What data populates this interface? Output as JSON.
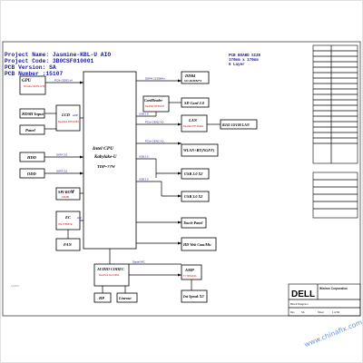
{
  "header": {
    "project_name": "Project Name: Jasmine-KBL-U AIO",
    "project_code": "Project Code: 3B0CSF010001",
    "pcb_version": "PCB Version: SA",
    "pcb_number": "PCB Number :15107"
  },
  "pcb_info": {
    "line1": "PCB BOARD SIZE",
    "line2": "170mm x 170mm",
    "line3": "6 Layer"
  },
  "blocks": {
    "cpu_title": "Intel CPU",
    "cpu_sub": "Kabylake-U",
    "cpu_tdp": "TDP=??W",
    "gpu": "GPU",
    "gpu_note": "NVidia N16S-GTR",
    "hdmi": "HDMI Input",
    "lcd": "LCD",
    "lcd_note": "RealTek RTD2281",
    "panel": "Panel",
    "hdd": "HDD",
    "odd": "ODD",
    "spi": "SPI ROM",
    "spi_note": "16MB",
    "ec": "EC",
    "ec_note": "ITE IT8987E",
    "fan": "FAN",
    "ddr": "DDR4",
    "ddr_sub": "SO-DIMM*2",
    "card_reader": "CardReader",
    "card_reader_note": "RealTek RTS5170",
    "sd": "SD Card 3.0",
    "lan": "LAN",
    "lan_note": "RealTek RTL8111H",
    "rj45": "RJ45 10/100 LAN",
    "wlan": "WLAN+BT(NGFF)",
    "usb2": "USB 2.0 X2",
    "usb3": "USB 3.0 X2",
    "touch": "Touch Panel",
    "hdcam": "HD Web Cam/Mic",
    "audio": "AUDIO CODEC",
    "audio_note": "RealTek ALC3661",
    "amp": "AMP",
    "amp_note": "TI TPA3131",
    "hp": "HP",
    "linein": "Lineout",
    "spk": "Int Speak X2"
  },
  "buses": {
    "pcie_gpu": "PCIe GEN3 x4",
    "dp_lcd": "eDP",
    "pcie_lan": "PCIe GEN2 X1",
    "pcie_wlan": "PCIe GEN2 X1",
    "sata_hdd": "SATA 3.0",
    "sata_odd": "SATA 3.0",
    "spi_bus": "SPI",
    "lpc_bus": "LPC",
    "ddr_bus": "DDR4 2133MHz",
    "usb_card": "USB 2.0",
    "usb2_bus": "USB 2.0",
    "usb3_bus": "USB 3.0",
    "hda_bus": "Digital MIC"
  },
  "title_block": {
    "company": "Wistron Corporation",
    "addr": "21F, 88, Sec.1, Hsin Tai Wu Rd., Hsichih, Taipei Hsien 221, Taiwan, R.O.C.",
    "brand": "DELL",
    "doc_title": "Block Diagram",
    "rev_label": "Rev",
    "rev": "SA",
    "sheet_label": "Sheet",
    "sheet": "1 of 99"
  },
  "watermark": "www.chinafix.com",
  "corner_note": "LOGO"
}
